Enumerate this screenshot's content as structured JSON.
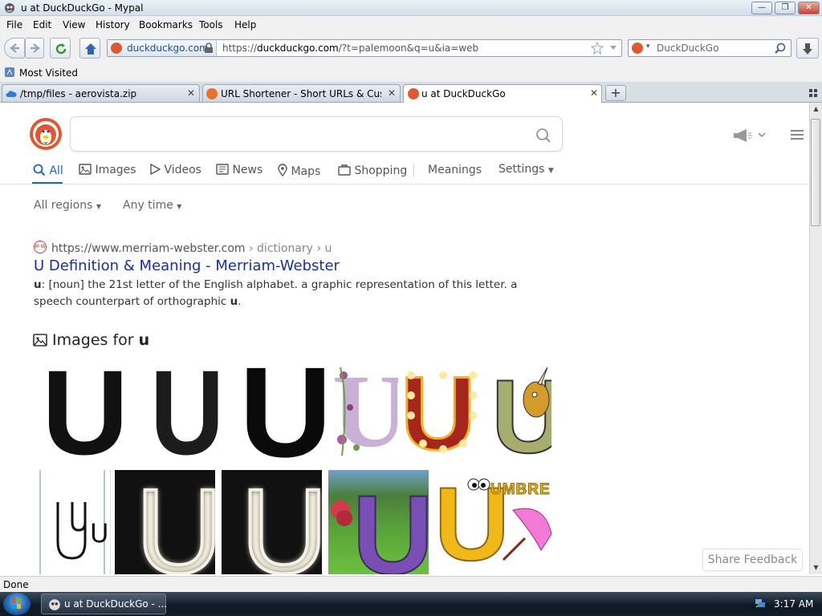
{
  "window": {
    "title": "u at DuckDuckGo - Mypal"
  },
  "menu": [
    "File",
    "Edit",
    "View",
    "History",
    "Bookmarks",
    "Tools",
    "Help"
  ],
  "nav": {
    "site_identity": "duckduckgo.com",
    "url_prefix": "https://",
    "url_domain": "duckduckgo.com",
    "url_rest": "/?t=palemoon&q=u&ia=web",
    "search_engine_placeholder": "DuckDuckGo"
  },
  "bookmarks": {
    "most_visited": "Most Visited"
  },
  "tabs": [
    {
      "label": "/tmp/files - aerovista.zip",
      "active": false
    },
    {
      "label": "URL Shortener - Short URLs & Custo...",
      "active": false
    },
    {
      "label": "u at DuckDuckGo",
      "active": true
    }
  ],
  "ddg": {
    "search_value": "",
    "nav_tabs": [
      "All",
      "Images",
      "Videos",
      "News",
      "Maps",
      "Shopping",
      "Meanings",
      "Settings"
    ],
    "filters": [
      "All regions",
      "Any time"
    ],
    "result": {
      "favicon_text": "M·W",
      "url": "https://www.merriam-webster.com",
      "breadcrumb": " › dictionary › u",
      "title": "U Definition & Meaning - Merriam-Webster",
      "snippet_bold": "u",
      "snippet_mid": ": [noun] the 21st letter of the English alphabet. a graphic representation of this letter. a speech counterpart of orthographic ",
      "snippet_bold2": "u",
      "snippet_end": "."
    },
    "images_heading": "Images for ",
    "images_heading_bold": "u",
    "image_letters": [
      "U",
      "U",
      "U",
      "U",
      "U",
      "U",
      "U",
      "U",
      "U",
      "U",
      "U"
    ],
    "umbrella_text": "UMBRE",
    "share_feedback": "Share Feedback"
  },
  "status": {
    "text": "Done"
  },
  "taskbar": {
    "item": "u at DuckDuckGo - ...",
    "clock": "3:17 AM"
  },
  "colors": {
    "ddg_orange": "#de5833",
    "link_blue": "#1a2da5",
    "active_tab_blue": "#1e63c4"
  }
}
